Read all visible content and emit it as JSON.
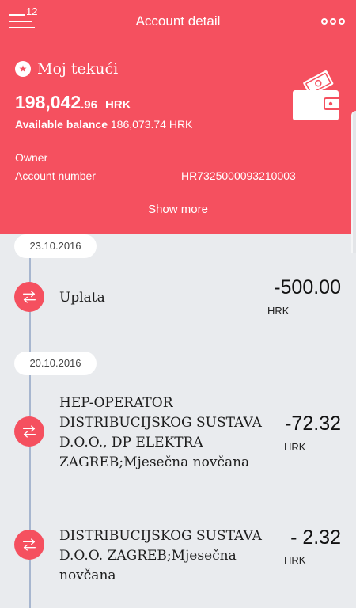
{
  "header": {
    "menu_badge": "12",
    "title": "Account detail",
    "account_name": "Moj tekući",
    "balance_int": "198,042",
    "balance_dec": ".96",
    "balance_currency": "HRK",
    "available_label": "Available balance",
    "available_value": "186,073.74 HRK",
    "owner_label": "Owner",
    "account_number_label": "Account number",
    "account_number_value": "HR7325000093210003",
    "show_more": "Show more"
  },
  "icons": {
    "menu": "hamburger-menu-icon",
    "more": "more-options-icon",
    "star": "star-icon",
    "wallet": "wallet-icon",
    "transfer": "transfer-arrows-icon"
  },
  "colors": {
    "accent": "#f5505f",
    "background": "#e9ebee",
    "timeline": "#a7b6cf"
  },
  "transactions": [
    {
      "date": "23.10.2016",
      "name": "Uplata",
      "amount": "-500.00",
      "currency": "HRK"
    },
    {
      "date": "20.10.2016",
      "name": "HEP-OPERATOR DISTRIBUCIJSKOG SUSTAVA D.O.O., DP ELEKTRA ZAGREB;Mjesečna novčana",
      "amount": "-72.32",
      "currency": "HRK"
    },
    {
      "date": "",
      "name": "DISTRIBUCIJSKOG SUSTAVA D.O.O. ZAGREB;Mjesečna novčana",
      "amount": "- 2.32",
      "currency": "HRK"
    }
  ]
}
